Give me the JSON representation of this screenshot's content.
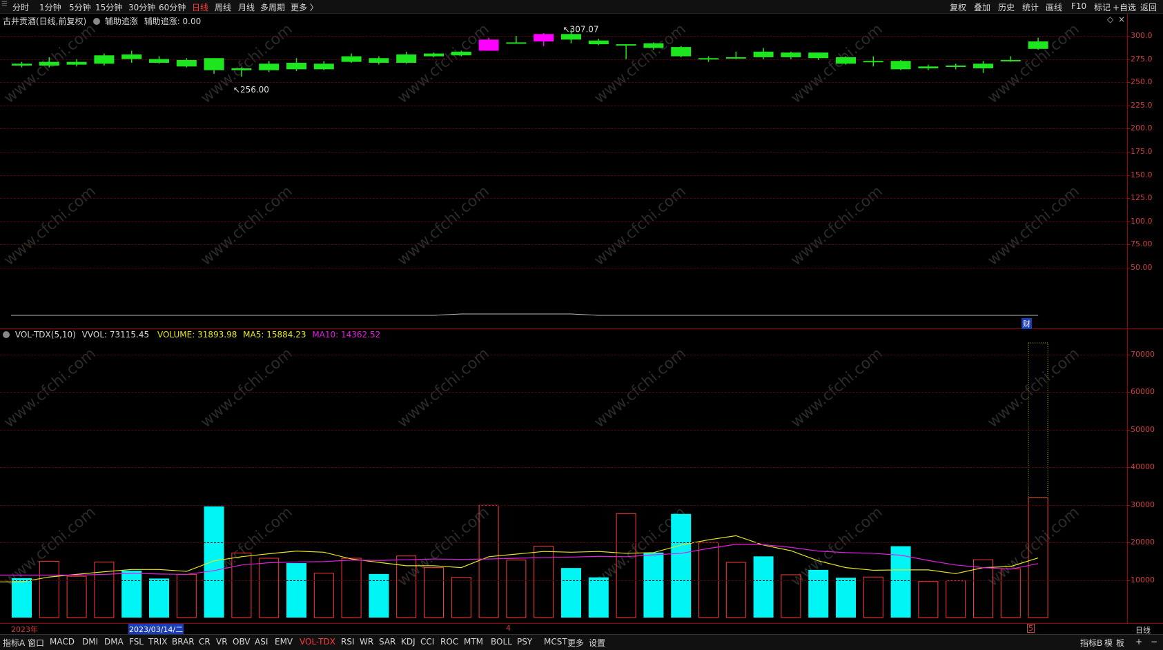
{
  "toolbar": {
    "left": [
      {
        "label": "分时",
        "active": false
      },
      {
        "label": "1分钟",
        "active": false
      },
      {
        "label": "5分钟",
        "active": false
      },
      {
        "label": "15分钟",
        "active": false
      },
      {
        "label": "30分钟",
        "active": false
      },
      {
        "label": "60分钟",
        "active": false
      },
      {
        "label": "日线",
        "active": true
      },
      {
        "label": "周线",
        "active": false
      },
      {
        "label": "月线",
        "active": false
      },
      {
        "label": "多周期",
        "active": false
      },
      {
        "label": "更多 〉",
        "active": false
      }
    ],
    "right": [
      "复权",
      "叠加",
      "历史",
      "统计",
      "画线",
      "F10",
      "标记",
      "+自选",
      "返回"
    ]
  },
  "price_panel": {
    "title": "古井贡酒(日线,前复权)",
    "aux_label": "辅助追涨",
    "aux_value": "辅助追涨: 0.00",
    "high_marker": "307.07",
    "low_marker": "256.00",
    "finance_marker": "财",
    "y_ticks": [
      "300.0",
      "275.0",
      "250.0",
      "225.0",
      "200.0",
      "175.0",
      "150.0",
      "125.0",
      "100.0",
      "75.00",
      "50.00"
    ]
  },
  "volume_panel": {
    "indicator": "VOL-TDX(5,10)",
    "vvol": "VVOL: 73115.45",
    "volume": "VOLUME: 31893.98",
    "ma5": "MA5: 15884.23",
    "ma10": "MA10: 14362.52",
    "y_ticks": [
      "70000",
      "60000",
      "50000",
      "40000",
      "30000",
      "20000",
      "10000"
    ]
  },
  "date_axis": {
    "year_label": "2023年",
    "cursor_date": "2023/03/14/二",
    "month4": "4",
    "month5": "5",
    "right_label": "日线"
  },
  "bottom_tabs": {
    "items": [
      {
        "label": "指标A",
        "active": false
      },
      {
        "label": "窗口",
        "active": false
      },
      {
        "label": "MACD",
        "active": false
      },
      {
        "label": "DMI",
        "active": false
      },
      {
        "label": "DMA",
        "active": false
      },
      {
        "label": "FSL",
        "active": false
      },
      {
        "label": "TRIX",
        "active": false
      },
      {
        "label": "BRAR",
        "active": false
      },
      {
        "label": "CR",
        "active": false
      },
      {
        "label": "VR",
        "active": false
      },
      {
        "label": "OBV",
        "active": false
      },
      {
        "label": "ASI",
        "active": false
      },
      {
        "label": "EMV",
        "active": false
      },
      {
        "label": "VOL-TDX",
        "active": true
      },
      {
        "label": "RSI",
        "active": false
      },
      {
        "label": "WR",
        "active": false
      },
      {
        "label": "SAR",
        "active": false
      },
      {
        "label": "KDJ",
        "active": false
      },
      {
        "label": "CCI",
        "active": false
      },
      {
        "label": "ROC",
        "active": false
      },
      {
        "label": "MTM",
        "active": false
      },
      {
        "label": "BOLL",
        "active": false
      },
      {
        "label": "PSY",
        "active": false
      },
      {
        "label": "MCST",
        "active": false
      },
      {
        "label": "更多",
        "active": false
      },
      {
        "label": "设置",
        "active": false
      }
    ],
    "right": [
      "指标B",
      "模",
      "板",
      "+",
      "−"
    ]
  },
  "watermark": "www.cfchi.com",
  "colors": {
    "up": "#ff3b3b",
    "down_candle": "#1ee61e",
    "down_volume": "#00f5f5",
    "limit_up": "#ff00ff",
    "ma5": "#e6e61e",
    "ma10": "#e01ee0",
    "axis": "#a00000"
  },
  "chart_data": [
    {
      "type": "candlestick",
      "title": "古井贡酒(日线,前复权)",
      "ylim": [
        50,
        300
      ],
      "candles": [
        {
          "open": 270,
          "close": 268,
          "high": 272,
          "low": 266,
          "color": "green"
        },
        {
          "open": 272,
          "close": 268,
          "high": 277,
          "low": 266,
          "color": "green"
        },
        {
          "open": 272,
          "close": 269,
          "high": 275,
          "low": 267,
          "color": "green"
        },
        {
          "open": 279,
          "close": 270,
          "high": 281,
          "low": 268,
          "color": "green"
        },
        {
          "open": 280,
          "close": 275,
          "high": 284,
          "low": 271,
          "color": "green"
        },
        {
          "open": 275,
          "close": 271,
          "high": 278,
          "low": 270,
          "color": "green"
        },
        {
          "open": 274,
          "close": 267,
          "high": 276,
          "low": 266,
          "color": "green"
        },
        {
          "open": 276,
          "close": 263,
          "high": 276,
          "low": 259,
          "color": "green"
        },
        {
          "open": 265,
          "close": 263,
          "high": 266,
          "low": 256,
          "color": "green"
        },
        {
          "open": 270,
          "close": 263,
          "high": 273,
          "low": 261,
          "color": "green"
        },
        {
          "open": 271,
          "close": 264,
          "high": 276,
          "low": 262,
          "color": "green"
        },
        {
          "open": 270,
          "close": 264,
          "high": 273,
          "low": 263,
          "color": "green"
        },
        {
          "open": 278,
          "close": 272,
          "high": 281,
          "low": 271,
          "color": "green"
        },
        {
          "open": 276,
          "close": 271,
          "high": 278,
          "low": 269,
          "color": "green"
        },
        {
          "open": 280,
          "close": 271,
          "high": 283,
          "low": 270,
          "color": "green"
        },
        {
          "open": 281,
          "close": 278,
          "high": 282,
          "low": 277,
          "color": "green"
        },
        {
          "open": 283,
          "close": 279,
          "high": 284,
          "low": 278,
          "color": "green"
        },
        {
          "open": 284,
          "close": 296,
          "high": 298,
          "low": 284,
          "color": "magenta"
        },
        {
          "open": 293,
          "close": 293,
          "high": 300,
          "low": 292,
          "color": "green"
        },
        {
          "open": 294,
          "close": 302,
          "high": 303,
          "low": 289,
          "color": "magenta"
        },
        {
          "open": 302,
          "close": 296,
          "high": 307.07,
          "low": 292,
          "color": "green"
        },
        {
          "open": 295,
          "close": 291,
          "high": 297,
          "low": 290,
          "color": "green"
        },
        {
          "open": 291,
          "close": 290,
          "high": 291,
          "low": 275,
          "color": "green"
        },
        {
          "open": 292,
          "close": 287,
          "high": 293,
          "low": 285,
          "color": "green"
        },
        {
          "open": 288,
          "close": 278,
          "high": 289,
          "low": 277,
          "color": "green"
        },
        {
          "open": 276,
          "close": 275,
          "high": 278,
          "low": 272,
          "color": "green"
        },
        {
          "open": 277,
          "close": 276,
          "high": 283,
          "low": 275,
          "color": "green"
        },
        {
          "open": 283,
          "close": 277,
          "high": 287,
          "low": 275,
          "color": "green"
        },
        {
          "open": 282,
          "close": 277,
          "high": 283,
          "low": 275,
          "color": "green"
        },
        {
          "open": 282,
          "close": 276,
          "high": 282,
          "low": 274,
          "color": "green"
        },
        {
          "open": 277,
          "close": 270,
          "high": 278,
          "low": 269,
          "color": "green"
        },
        {
          "open": 273,
          "close": 272,
          "high": 278,
          "low": 267,
          "color": "green"
        },
        {
          "open": 273,
          "close": 264,
          "high": 274,
          "low": 263,
          "color": "green"
        },
        {
          "open": 267,
          "close": 265,
          "high": 269,
          "low": 263,
          "color": "green"
        },
        {
          "open": 268,
          "close": 267,
          "high": 270,
          "low": 264,
          "color": "green"
        },
        {
          "open": 270,
          "close": 265,
          "high": 273,
          "low": 260,
          "color": "green"
        },
        {
          "open": 274,
          "close": 273,
          "high": 278,
          "low": 272,
          "color": "green"
        },
        {
          "open": 294,
          "close": 286,
          "high": 298,
          "low": 285,
          "color": "green"
        }
      ]
    },
    {
      "type": "bar",
      "title": "VOL-TDX(5,10)",
      "ylim": [
        0,
        73500
      ],
      "bars": [
        {
          "value": 10500,
          "style": "solid"
        },
        {
          "value": 15000,
          "style": "hollow"
        },
        {
          "value": 11000,
          "style": "hollow"
        },
        {
          "value": 14800,
          "style": "hollow"
        },
        {
          "value": 12500,
          "style": "solid"
        },
        {
          "value": 10400,
          "style": "solid"
        },
        {
          "value": 11500,
          "style": "hollow"
        },
        {
          "value": 29600,
          "style": "solid"
        },
        {
          "value": 17200,
          "style": "hollow"
        },
        {
          "value": 15800,
          "style": "hollow"
        },
        {
          "value": 14500,
          "style": "solid"
        },
        {
          "value": 11800,
          "style": "hollow"
        },
        {
          "value": 15800,
          "style": "hollow"
        },
        {
          "value": 11600,
          "style": "solid"
        },
        {
          "value": 16400,
          "style": "hollow"
        },
        {
          "value": 13300,
          "style": "hollow"
        },
        {
          "value": 10700,
          "style": "hollow"
        },
        {
          "value": 29900,
          "style": "hollow"
        },
        {
          "value": 15300,
          "style": "hollow"
        },
        {
          "value": 19000,
          "style": "hollow"
        },
        {
          "value": 13200,
          "style": "solid"
        },
        {
          "value": 10700,
          "style": "solid"
        },
        {
          "value": 27700,
          "style": "hollow"
        },
        {
          "value": 17300,
          "style": "solid"
        },
        {
          "value": 27600,
          "style": "solid"
        },
        {
          "value": 20000,
          "style": "hollow"
        },
        {
          "value": 14700,
          "style": "hollow"
        },
        {
          "value": 16300,
          "style": "solid"
        },
        {
          "value": 11400,
          "style": "hollow"
        },
        {
          "value": 12700,
          "style": "solid"
        },
        {
          "value": 10600,
          "style": "solid"
        },
        {
          "value": 10800,
          "style": "hollow"
        },
        {
          "value": 19000,
          "style": "solid"
        },
        {
          "value": 9600,
          "style": "hollow"
        },
        {
          "value": 9800,
          "style": "hollow"
        },
        {
          "value": 15400,
          "style": "hollow"
        },
        {
          "value": 13000,
          "style": "hollow"
        },
        {
          "value": 31893.98,
          "style": "hollow",
          "vvol": 73115.45
        }
      ],
      "series": [
        {
          "name": "MA5",
          "values": [
            9500,
            10800,
            11500,
            12200,
            12800,
            12800,
            12300,
            15100,
            16200,
            17000,
            17700,
            17400,
            15600,
            14700,
            13800,
            13800,
            13300,
            16200,
            16900,
            17600,
            17400,
            17600,
            17100,
            17300,
            19300,
            20700,
            21800,
            19300,
            17800,
            15100,
            13300,
            12600,
            12700,
            12700,
            11700,
            13300,
            13600,
            15884.23
          ]
        },
        {
          "name": "MA10",
          "values": [
            11300,
            11300,
            11300,
            11500,
            11800,
            11600,
            11500,
            12500,
            14000,
            14600,
            14800,
            14900,
            15300,
            15200,
            15400,
            15600,
            15500,
            15600,
            15800,
            16000,
            16100,
            16300,
            16200,
            16700,
            17100,
            18400,
            19500,
            19400,
            18700,
            17700,
            17300,
            17100,
            16600,
            15200,
            14000,
            13300,
            12900,
            14362.52
          ]
        }
      ]
    }
  ]
}
